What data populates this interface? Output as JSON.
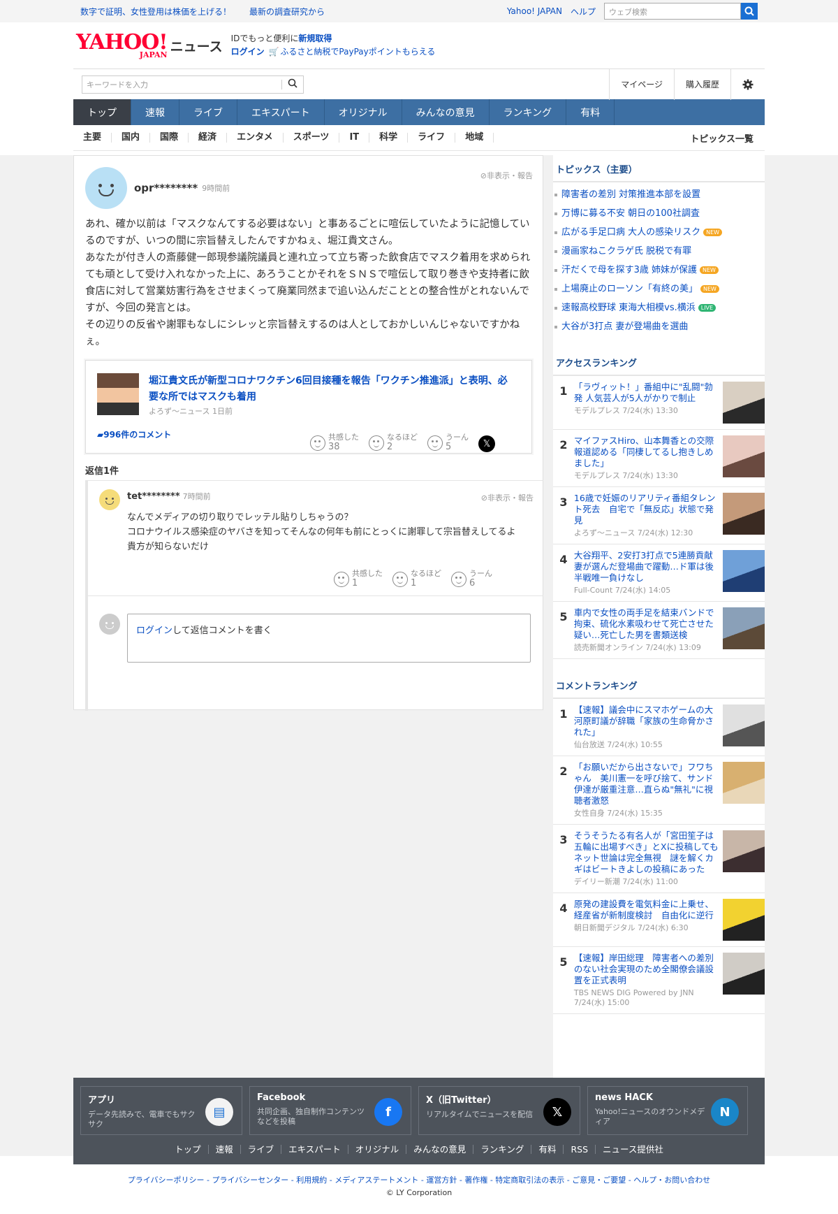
{
  "topbar": {
    "promo1": "数字で証明、女性登用は株価を上げる！",
    "promo2": "最新の調査研究から",
    "yahoo_japan": "Yahoo! JAPAN",
    "help": "ヘルプ",
    "web_search_placeholder": "ウェブ検索"
  },
  "header": {
    "logo_yahoo": "YAHOO!",
    "logo_japan": "JAPAN",
    "logo_news": "ニュース",
    "id_text": "IDでもっと便利に",
    "signup": "新規取得",
    "login": "ログイン",
    "furusato": "ふるさと納税でPayPayポイントもらえる"
  },
  "search": {
    "placeholder": "キーワードを入力",
    "mypage": "マイページ",
    "history": "購入履歴"
  },
  "mainnav": [
    "トップ",
    "速報",
    "ライブ",
    "エキスパート",
    "オリジナル",
    "みんなの意見",
    "ランキング",
    "有料"
  ],
  "subnav": [
    "主要",
    "国内",
    "国際",
    "経済",
    "エンタメ",
    "スポーツ",
    "IT",
    "科学",
    "ライフ",
    "地域"
  ],
  "subnav_topics": "トピックス一覧",
  "comment": {
    "user": "opr********",
    "time": "9時間前",
    "hide_report": "非表示・報告",
    "body": "あれ、確か以前は「マスクなんてする必要はない」と事あるごとに喧伝していたように記憶しているのですが、いつの間に宗旨替えしたんですかねぇ、堀江貴文さん。\nあなたが付き人の斎藤健一郎現参議院議員と連れ立って立ち寄った飲食店でマスク着用を求められても頑として受け入れなかった上に、あろうことかそれをＳＮＳで喧伝して取り巻きや支持者に飲食店に対して営業妨害行為をさせまくって廃業同然まで追い込んだこととの整合性がとれないんですが、今回の発言とは。\nその辺りの反省や謝罪もなしにシレッと宗旨替えするのは人としておかしいんじゃないですかねぇ。",
    "article_title": "堀江貴文氏が新型コロナワクチン6回目接種を報告「ワクチン推進派」と表明、必要な所ではマスクも着用",
    "article_source": "よろず～ニュース 1日前",
    "article_comments": "996件のコメント",
    "reactions": [
      {
        "label": "共感した",
        "count": "38"
      },
      {
        "label": "なるほど",
        "count": "2"
      },
      {
        "label": "うーん",
        "count": "5"
      }
    ],
    "reply_count": "返信1件"
  },
  "reply": {
    "user": "tet********",
    "time": "7時間前",
    "hide_report": "非表示・報告",
    "body": "なんでメディアの切り取りでレッテル貼りしちゃうの？\nコロナウイルス感染症のヤバさを知ってそんなの何年も前にとっくに謝罪して宗旨替えしてるよ\n貴方が知らないだけ",
    "reactions": [
      {
        "label": "共感した",
        "count": "1"
      },
      {
        "label": "なるほど",
        "count": "1"
      },
      {
        "label": "うーん",
        "count": "6"
      }
    ],
    "compose_login": "ログイン",
    "compose_text": "して返信コメントを書く"
  },
  "sidebar": {
    "topics_title": "トピックス（主要）",
    "topics": [
      {
        "text": "障害者の差別 対策推進本部を設置",
        "badge": ""
      },
      {
        "text": "万博に募る不安 朝日の100社調査",
        "badge": ""
      },
      {
        "text": "広がる手足口病 大人の感染リスク",
        "badge": "NEW"
      },
      {
        "text": "漫画家ねこクラゲ氏 脱税で有罪",
        "badge": ""
      },
      {
        "text": "汗だくで母を探す3歳 姉妹が保護",
        "badge": "NEW"
      },
      {
        "text": "上場廃止のローソン「有終の美」",
        "badge": "NEW"
      },
      {
        "text": "速報高校野球 東海大相模vs.横浜",
        "badge": "LIVE"
      },
      {
        "text": "大谷が3打点 妻が登場曲を選曲",
        "badge": ""
      }
    ],
    "access_title": "アクセスランキング",
    "access": [
      {
        "rank": "1",
        "title": "「ラヴィット！」番組中に\"乱闘\"勃発 人気芸人が5人がかりで制止",
        "source": "モデルプレス 7/24(水) 13:30"
      },
      {
        "rank": "2",
        "title": "マイファスHiro、山本舞香との交際報道認める「同棲してるし抱きしめました」",
        "source": "モデルプレス 7/24(水) 13:30"
      },
      {
        "rank": "3",
        "title": "16歳で妊娠のリアリティ番組タレント死去　自宅で「無反応」状態で発見",
        "source": "よろず～ニュース 7/24(水) 12:30"
      },
      {
        "rank": "4",
        "title": "大谷翔平、2安打3打点で5連勝貢献　妻が選んだ登場曲で躍動…ド軍は後半戦唯一負けなし",
        "source": "Full-Count 7/24(水) 14:05"
      },
      {
        "rank": "5",
        "title": "車内で女性の両手足を結束バンドで拘束、硫化水素吸わせて死亡させた疑い…死亡した男を書類送検",
        "source": "読売新聞オンライン 7/24(水) 13:09"
      }
    ],
    "comment_title": "コメントランキング",
    "comments": [
      {
        "rank": "1",
        "title": "【速報】議会中にスマホゲームの大河原町議が辞職「家族の生命脅かされた」",
        "source": "仙台放送 7/24(水) 10:55"
      },
      {
        "rank": "2",
        "title": "「お願いだから出さないで」フワちゃん　美川憲一を呼び捨て、サンド伊達が厳重注意…直らぬ\"無礼\"に視聴者激怒",
        "source": "女性自身 7/24(水) 15:35"
      },
      {
        "rank": "3",
        "title": "そうそうたる有名人が「宮田笙子は五輪に出場すべき」とXに投稿してもネット世論は完全無視　謎を解くカギはビートきよしの投稿にあった",
        "source": "デイリー新潮 7/24(水) 11:00"
      },
      {
        "rank": "4",
        "title": "原発の建設費を電気料金に上乗せ、経産省が新制度検討　自由化に逆行",
        "source": "朝日新聞デジタル 7/24(水) 6:30"
      },
      {
        "rank": "5",
        "title": "【速報】岸田総理　障害者への差別のない社会実現のため全閣僚会議設置を正式表明",
        "source": "TBS NEWS DIG Powered by JNN 7/24(水) 15:00"
      }
    ]
  },
  "footer": {
    "apps": [
      {
        "title": "アプリ",
        "desc": "データ先読みで、電車でもサクサク",
        "icon": "app-icon"
      },
      {
        "title": "Facebook",
        "desc": "共同企画、独自制作コンテンツなどを投稿",
        "icon": "facebook-icon"
      },
      {
        "title": "X（旧Twitter）",
        "desc": "リアルタイムでニュースを配信",
        "icon": "x-icon"
      },
      {
        "title": "news HACK",
        "desc": "Yahoo!ニュースのオウンドメディア",
        "icon": "newshack-icon"
      }
    ],
    "nav": [
      "トップ",
      "速報",
      "ライブ",
      "エキスパート",
      "オリジナル",
      "みんなの意見",
      "ランキング",
      "有料",
      "RSS",
      "ニュース提供社"
    ],
    "legal": "プライバシーポリシー - プライバシーセンター - 利用規約 - メディアステートメント - 運営方針 - 著作権 - 特定商取引法の表示 - ご意見・ご要望 - ヘルプ・お問い合わせ",
    "copyright": "© LY Corporation"
  },
  "colors": {
    "accent": "#0a4fc2",
    "nav_bg": "#3d6fa3",
    "nav_active": "#3a3f47",
    "brand_red": "#ff0033"
  }
}
